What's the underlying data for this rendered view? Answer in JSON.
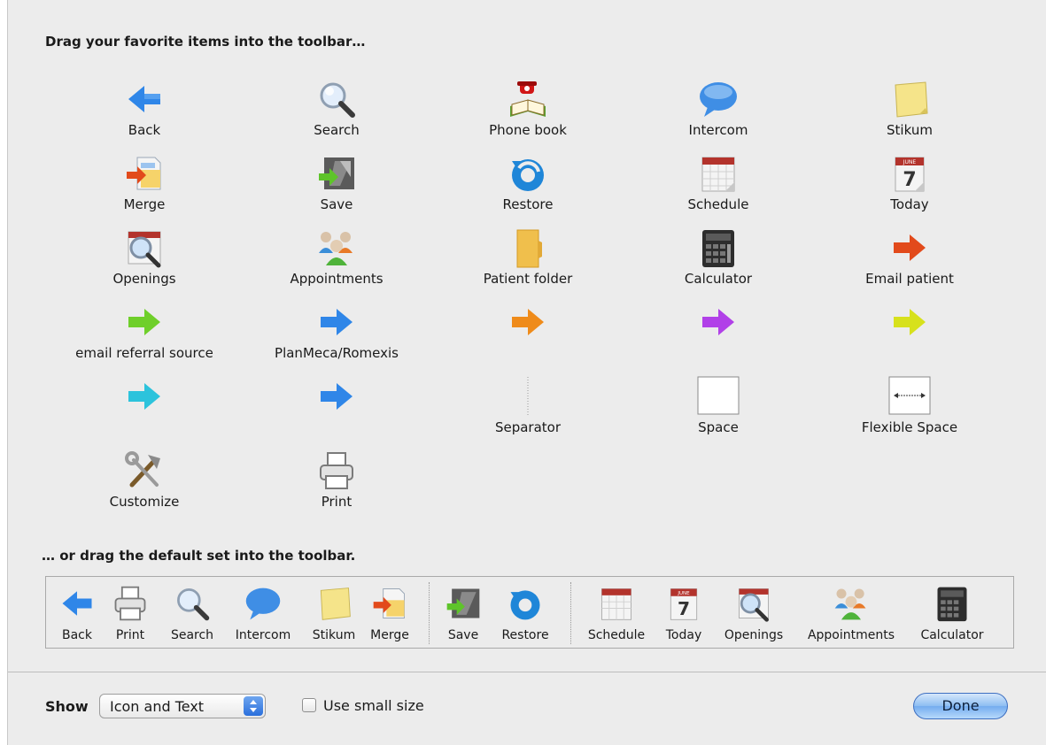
{
  "headings": {
    "favorites": "Drag your favorite items into the toolbar…",
    "default_set": "… or drag the default set into the toolbar."
  },
  "palette": [
    {
      "label": "Back",
      "icon": "back-arrow-icon"
    },
    {
      "label": "Search",
      "icon": "magnifier-icon"
    },
    {
      "label": "Phone book",
      "icon": "phone-book-icon"
    },
    {
      "label": "Intercom",
      "icon": "speech-bubble-icon"
    },
    {
      "label": "Stikum",
      "icon": "sticky-note-icon"
    },
    {
      "label": "Merge",
      "icon": "merge-icon"
    },
    {
      "label": "Save",
      "icon": "save-icon"
    },
    {
      "label": "Restore",
      "icon": "restore-icon"
    },
    {
      "label": "Schedule",
      "icon": "calendar-icon"
    },
    {
      "label": "Today",
      "icon": "today-calendar-icon"
    },
    {
      "label": "Openings",
      "icon": "openings-icon"
    },
    {
      "label": "Appointments",
      "icon": "people-icon"
    },
    {
      "label": "Patient folder",
      "icon": "folder-icon"
    },
    {
      "label": "Calculator",
      "icon": "calculator-icon"
    },
    {
      "label": "Email patient",
      "icon": "red-arrow-icon"
    },
    {
      "label": "email referral source",
      "icon": "green-arrow-icon"
    },
    {
      "label": "PlanMeca/Romexis",
      "icon": "blue-arrow-icon"
    },
    {
      "label": "",
      "icon": "orange-arrow-icon"
    },
    {
      "label": "",
      "icon": "purple-arrow-icon"
    },
    {
      "label": "",
      "icon": "yellow-arrow-icon"
    },
    {
      "label": "",
      "icon": "cyan-arrow-icon"
    },
    {
      "label": "",
      "icon": "blue-arrow-icon"
    },
    {
      "label": "Separator",
      "icon": "separator-icon"
    },
    {
      "label": "Space",
      "icon": "space-icon"
    },
    {
      "label": "Flexible Space",
      "icon": "flexible-space-icon"
    },
    {
      "label": "Customize",
      "icon": "tools-icon"
    },
    {
      "label": "Print",
      "icon": "printer-icon"
    }
  ],
  "default_set": [
    {
      "label": "Back",
      "icon": "back-arrow-icon"
    },
    {
      "label": "Print",
      "icon": "printer-icon"
    },
    {
      "label": "Search",
      "icon": "magnifier-icon"
    },
    {
      "label": "Intercom",
      "icon": "speech-bubble-icon"
    },
    {
      "label": "Stikum",
      "icon": "sticky-note-icon"
    },
    {
      "label": "Merge",
      "icon": "merge-icon"
    },
    {
      "label": "Save",
      "icon": "save-icon"
    },
    {
      "label": "Restore",
      "icon": "restore-icon"
    },
    {
      "label": "Schedule",
      "icon": "calendar-icon"
    },
    {
      "label": "Today",
      "icon": "today-calendar-icon"
    },
    {
      "label": "Openings",
      "icon": "openings-icon"
    },
    {
      "label": "Appointments",
      "icon": "people-icon"
    },
    {
      "label": "Calculator",
      "icon": "calculator-icon"
    }
  ],
  "footer": {
    "show_label": "Show",
    "show_value": "Icon and Text",
    "small_size_label": "Use small size",
    "small_size_checked": false,
    "done_label": "Done"
  },
  "calendar": {
    "month": "JUNE",
    "day": "7"
  },
  "colors": {
    "sheet_bg": "#ececec",
    "blue_arrow": "#2f86e8",
    "red_arrow": "#e24a1b",
    "green_arrow": "#6fcf2a",
    "orange_arrow": "#ef8b1a",
    "purple_arrow": "#b140e8",
    "yellow_arrow": "#d7e11c",
    "cyan_arrow": "#2cc3dc",
    "done_button": "#7ab3f0"
  }
}
